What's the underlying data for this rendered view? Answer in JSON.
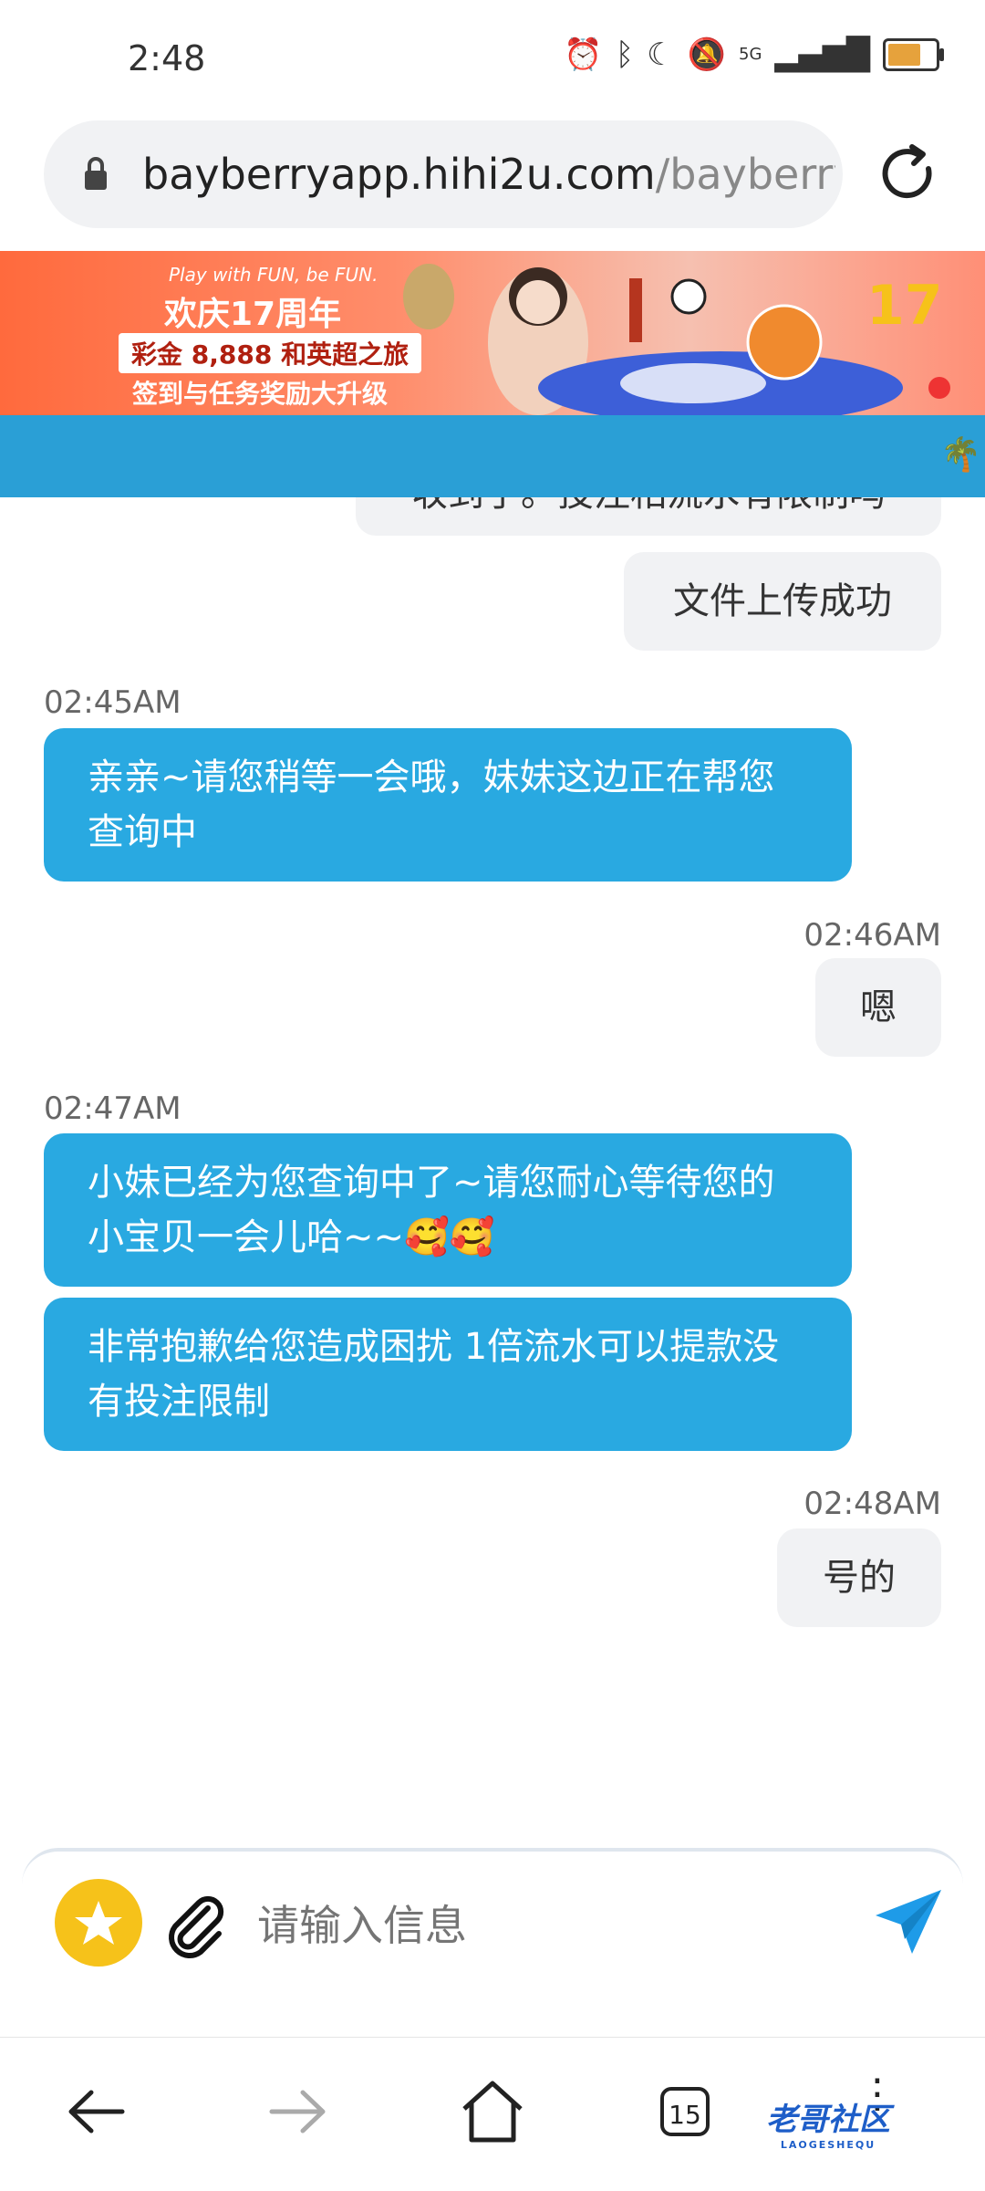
{
  "status_bar": {
    "time": "2:48",
    "network": "5G"
  },
  "browser": {
    "url_host": "bayberryapp.hihi2u.com",
    "url_path": "/bayberry"
  },
  "banner": {
    "tagline": "Play with FUN, be FUN.",
    "title": "欢庆17周年",
    "prize": "彩金 8,888 和英超之旅",
    "subtitle": "签到与任务奖励大升级"
  },
  "chat": {
    "messages": [
      {
        "from": "me",
        "text": "收到了。投注相流水有限制吗"
      },
      {
        "from": "me",
        "text": "文件上传成功"
      },
      {
        "from": "agent",
        "time": "02:45AM",
        "text": "亲亲~请您稍等一会哦，妹妹这边正在帮您查询中"
      },
      {
        "from": "me",
        "time": "02:46AM",
        "text": "嗯"
      },
      {
        "from": "agent",
        "time": "02:47AM",
        "text": "小妹已经为您查询中了~请您耐心等待您的小宝贝一会儿哈~~🥰🥰"
      },
      {
        "from": "agent",
        "text": "非常抱歉给您造成困扰 1倍流水可以提款没有投注限制"
      },
      {
        "from": "me",
        "time": "02:48AM",
        "text": "号的"
      }
    ]
  },
  "composer": {
    "placeholder": "请输入信息"
  },
  "nav": {
    "tab_count": "15"
  },
  "watermark": {
    "text": "老哥社区",
    "sub": "LAOGESHEQU"
  },
  "colors": {
    "agent_bubble": "#29a9e1",
    "user_bubble": "#f1f2f4",
    "accent_star": "#f6c21a",
    "send": "#1e9be8"
  }
}
